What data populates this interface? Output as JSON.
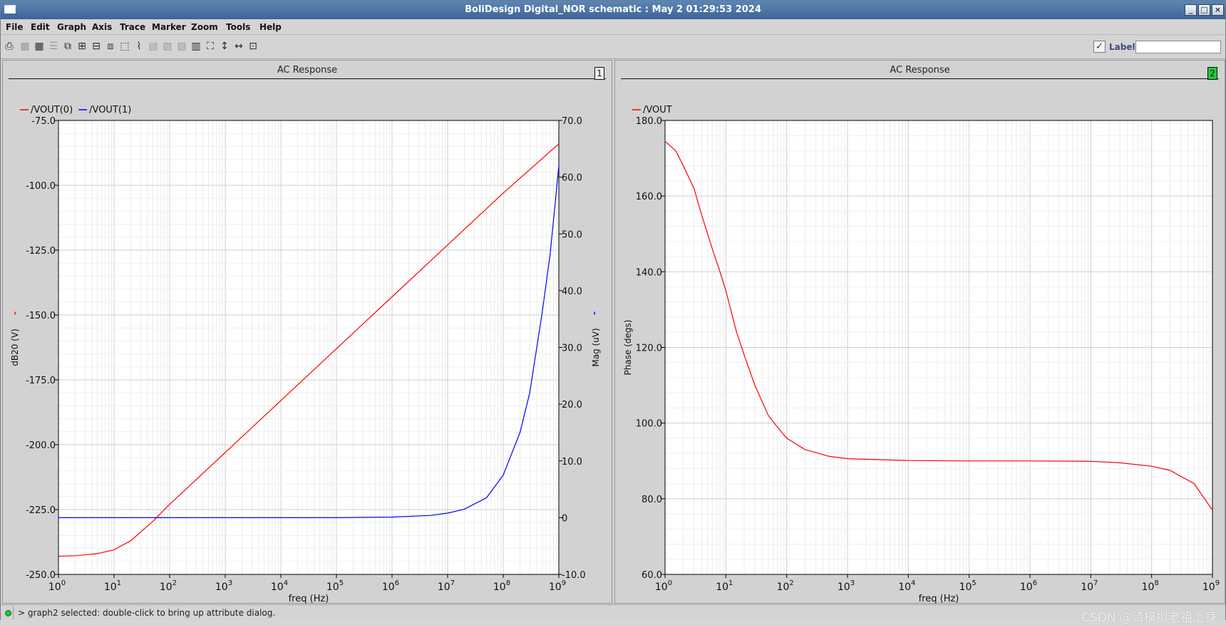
{
  "window": {
    "title": "BoliDesign Digital_NOR schematic : May  2 01:29:53 2024",
    "buttons": [
      "_",
      "□",
      "×"
    ]
  },
  "menu": [
    "File",
    "Edit",
    "Graph",
    "Axis",
    "Trace",
    "Marker",
    "Zoom",
    "Tools",
    "Help"
  ],
  "toolbar": {
    "icons": [
      "print-icon",
      "print-preview-icon",
      "grid-icon",
      "strip-icon",
      "new-window-icon",
      "add-subwindow-icon",
      "delete-subwindow-icon",
      "fit-window-icon",
      "marker-icon",
      "trace-icon",
      "trace-style-icon",
      "trace-chart-icon",
      "calculator-icon",
      "zoom-fit-icon",
      "zoom-y-icon",
      "zoom-x-icon",
      "zoom-box-icon"
    ],
    "label_text": "Label",
    "label_checked": true,
    "label_value": ""
  },
  "colors": {
    "red": "#ff0000",
    "blue": "#0000ff"
  },
  "panels": [
    {
      "title": "AC Response",
      "number": "1",
      "active": false
    },
    {
      "title": "AC Response",
      "number": "2",
      "active": true
    }
  ],
  "chart_data": [
    {
      "type": "line",
      "x_scale": "log",
      "xlim": [
        1,
        1000000000
      ],
      "xlabel": "freq (Hz)",
      "x_ticks": [
        "10",
        "10",
        "10",
        "10",
        "10",
        "10",
        "10",
        "10",
        "10",
        "10"
      ],
      "x_tick_exponents": [
        "0",
        "1",
        "2",
        "3",
        "4",
        "5",
        "6",
        "7",
        "8",
        "9"
      ],
      "grid": true,
      "legend": "top-left",
      "y_left": {
        "label": "dB20 (V)",
        "ylim": [
          -250,
          -75
        ],
        "ticks": [
          "-75.0",
          "-100.0",
          "-125.0",
          "-150.0",
          "-175.0",
          "-200.0",
          "-225.0",
          "-250.0"
        ],
        "tick_values": [
          -75,
          -100,
          -125,
          -150,
          -175,
          -200,
          -225,
          -250
        ]
      },
      "y_right": {
        "label": "Mag (uV)",
        "ylim": [
          -10,
          70
        ],
        "ticks": [
          "70.0",
          "60.0",
          "50.0",
          "40.0",
          "30.0",
          "20.0",
          "10.0",
          "0",
          "-10.0"
        ],
        "tick_values": [
          70,
          60,
          50,
          40,
          30,
          20,
          10,
          0,
          -10
        ]
      },
      "series": [
        {
          "name": "/VOUT(0)",
          "color": "#ff0000",
          "axis": "left",
          "x": [
            1,
            2,
            5,
            10,
            20,
            50,
            100,
            1000,
            10000,
            100000,
            1000000,
            10000000,
            100000000,
            1000000000
          ],
          "y": [
            -243.0,
            -242.8,
            -242.0,
            -240.5,
            -237.0,
            -229.5,
            -223.0,
            -203.0,
            -183.0,
            -163.0,
            -143.0,
            -123.0,
            -103.0,
            -84.0
          ]
        },
        {
          "name": "/VOUT(1)",
          "color": "#0000ff",
          "axis": "right",
          "x": [
            1,
            1000,
            100000,
            1000000,
            5000000,
            10000000,
            20000000,
            50000000,
            100000000,
            200000000,
            300000000,
            500000000,
            700000000,
            1000000000
          ],
          "y": [
            0.0,
            0.0,
            0.0,
            0.1,
            0.4,
            0.8,
            1.5,
            3.5,
            7.5,
            15.0,
            22.0,
            36.0,
            46.5,
            62.0
          ]
        }
      ]
    },
    {
      "type": "line",
      "x_scale": "log",
      "xlim": [
        1,
        1000000000
      ],
      "xlabel": "freq (Hz)",
      "x_ticks": [
        "10",
        "10",
        "10",
        "10",
        "10",
        "10",
        "10",
        "10",
        "10",
        "10"
      ],
      "x_tick_exponents": [
        "0",
        "1",
        "2",
        "3",
        "4",
        "5",
        "6",
        "7",
        "8",
        "9"
      ],
      "grid": true,
      "legend": "top-left",
      "y_left": {
        "label": "Phase (degs)",
        "ylim": [
          60,
          180
        ],
        "ticks": [
          "180.0",
          "160.0",
          "140.0",
          "120.0",
          "100.0",
          "80.0",
          "60.0"
        ],
        "tick_values": [
          180,
          160,
          140,
          120,
          100,
          80,
          60
        ]
      },
      "series": [
        {
          "name": "/VOUT",
          "color": "#ff0000",
          "axis": "left",
          "x": [
            1,
            1.5,
            2,
            3,
            4,
            6,
            8,
            10,
            15,
            20,
            30,
            50,
            70,
            100,
            200,
            500,
            1000,
            10000,
            100000,
            1000000,
            10000000,
            30000000,
            100000000,
            200000000,
            500000000,
            1000000000
          ],
          "y": [
            174.5,
            172.0,
            168.0,
            162.0,
            155.0,
            146.0,
            140.0,
            135.0,
            124.0,
            118.0,
            110.0,
            102.0,
            99.0,
            96.0,
            93.0,
            91.2,
            90.6,
            90.1,
            90.0,
            90.0,
            89.9,
            89.5,
            88.6,
            87.5,
            84.0,
            77.0
          ]
        }
      ]
    }
  ],
  "status": {
    "text": "> graph2 selected: double-click to bring up attribute dialog.",
    "watermark": "CSDN @请模拟老祖上身"
  }
}
